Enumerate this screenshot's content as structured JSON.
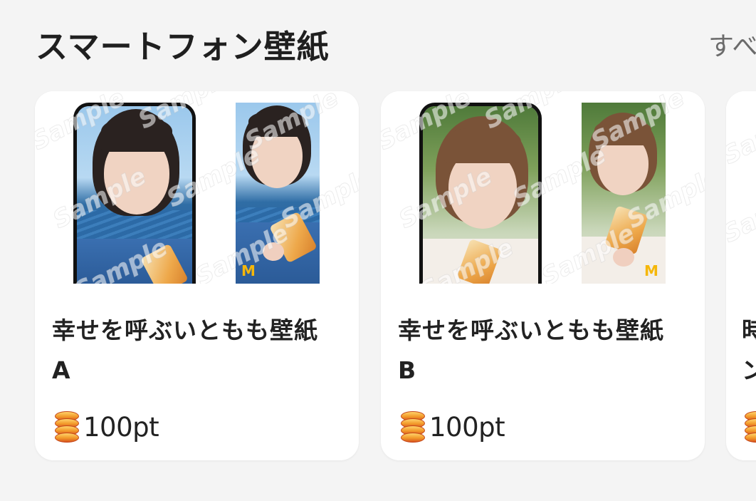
{
  "section": {
    "title": "スマートフォン壁紙",
    "see_all_label": "すべ"
  },
  "watermark_text": "Sample",
  "cards": [
    {
      "title": "幸せを呼ぶいともも壁紙 A",
      "price": "100pt",
      "icon": "coin-stack-icon"
    },
    {
      "title": "幸せを呼ぶいともも壁紙 B",
      "price": "100pt",
      "icon": "coin-stack-icon"
    },
    {
      "title": "時",
      "title_line2": "ン",
      "icon": "coin-stack-icon"
    }
  ],
  "colors": {
    "background": "#f4f4f4",
    "card": "#ffffff",
    "text": "#222222",
    "muted": "#6b6b6b",
    "coin": "#f29a2a",
    "mcd_logo": "#f5b70a"
  },
  "logo_glyph": "M"
}
